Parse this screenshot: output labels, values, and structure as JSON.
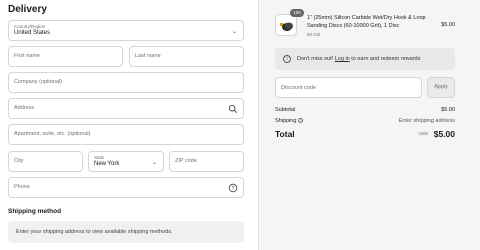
{
  "delivery": {
    "heading": "Delivery",
    "country": {
      "label": "Country/Region",
      "value": "United States"
    },
    "first_name": {
      "placeholder": "First name"
    },
    "last_name": {
      "placeholder": "Last name"
    },
    "company": {
      "placeholder": "Company (optional)"
    },
    "address": {
      "placeholder": "Address"
    },
    "apartment": {
      "placeholder": "Apartment, suite, etc. (optional)"
    },
    "city": {
      "placeholder": "City"
    },
    "state": {
      "label": "State",
      "value": "New York"
    },
    "zip": {
      "placeholder": "ZIP code"
    },
    "phone": {
      "placeholder": "Phone"
    }
  },
  "shipping": {
    "heading": "Shipping method",
    "message": "Enter your shipping address to view available shipping methods."
  },
  "summary": {
    "product": {
      "quantity": "100",
      "name": "1\" (25mm) Silicon Carbide Wet/Dry Hook & Loop Sanding Discs (60-10000 Grit), 1 Disc",
      "variant": "60 Grit",
      "price": "$5.00"
    },
    "rewards": {
      "prefix": "Don't miss out! ",
      "link": "Log in",
      "suffix": " to earn and redeem rewards"
    },
    "discount": {
      "placeholder": "Discount code",
      "apply_label": "Apply"
    },
    "subtotal": {
      "label": "Subtotal",
      "value": "$5.00"
    },
    "shipping": {
      "label": "Shipping",
      "value": "Enter shipping address"
    },
    "total": {
      "label": "Total",
      "currency": "USD",
      "value": "$5.00"
    }
  }
}
